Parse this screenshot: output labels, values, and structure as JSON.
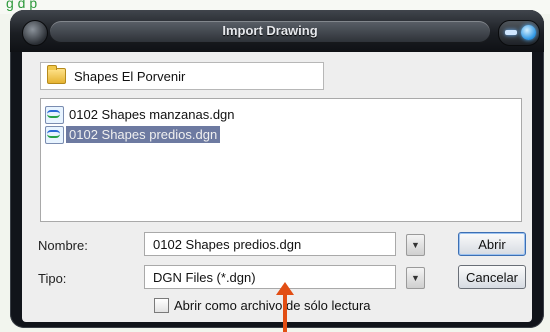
{
  "header": {
    "partial_text": "g d      p"
  },
  "dialog": {
    "title": "Import Drawing",
    "folder": {
      "name": "Shapes El Porvenir",
      "icon": "folder-icon"
    },
    "files": [
      {
        "name": "0102 Shapes manzanas.dgn",
        "icon": "dgn-file-icon",
        "selected": false
      },
      {
        "name": "0102 Shapes predios.dgn",
        "icon": "dgn-file-icon",
        "selected": true
      }
    ],
    "nombre": {
      "label": "Nombre:",
      "value": "0102 Shapes predios.dgn"
    },
    "tipo": {
      "label": "Tipo:",
      "value": "DGN Files (*.dgn)"
    },
    "buttons": {
      "open": "Abrir",
      "cancel": "Cancelar"
    },
    "readonly_checkbox": {
      "label": "Abrir como archivo de sólo lectura",
      "checked": false
    }
  },
  "colors": {
    "selection": "#6d7aa1",
    "annotation_arrow": "#e24e14",
    "chrome": "#11141a"
  }
}
